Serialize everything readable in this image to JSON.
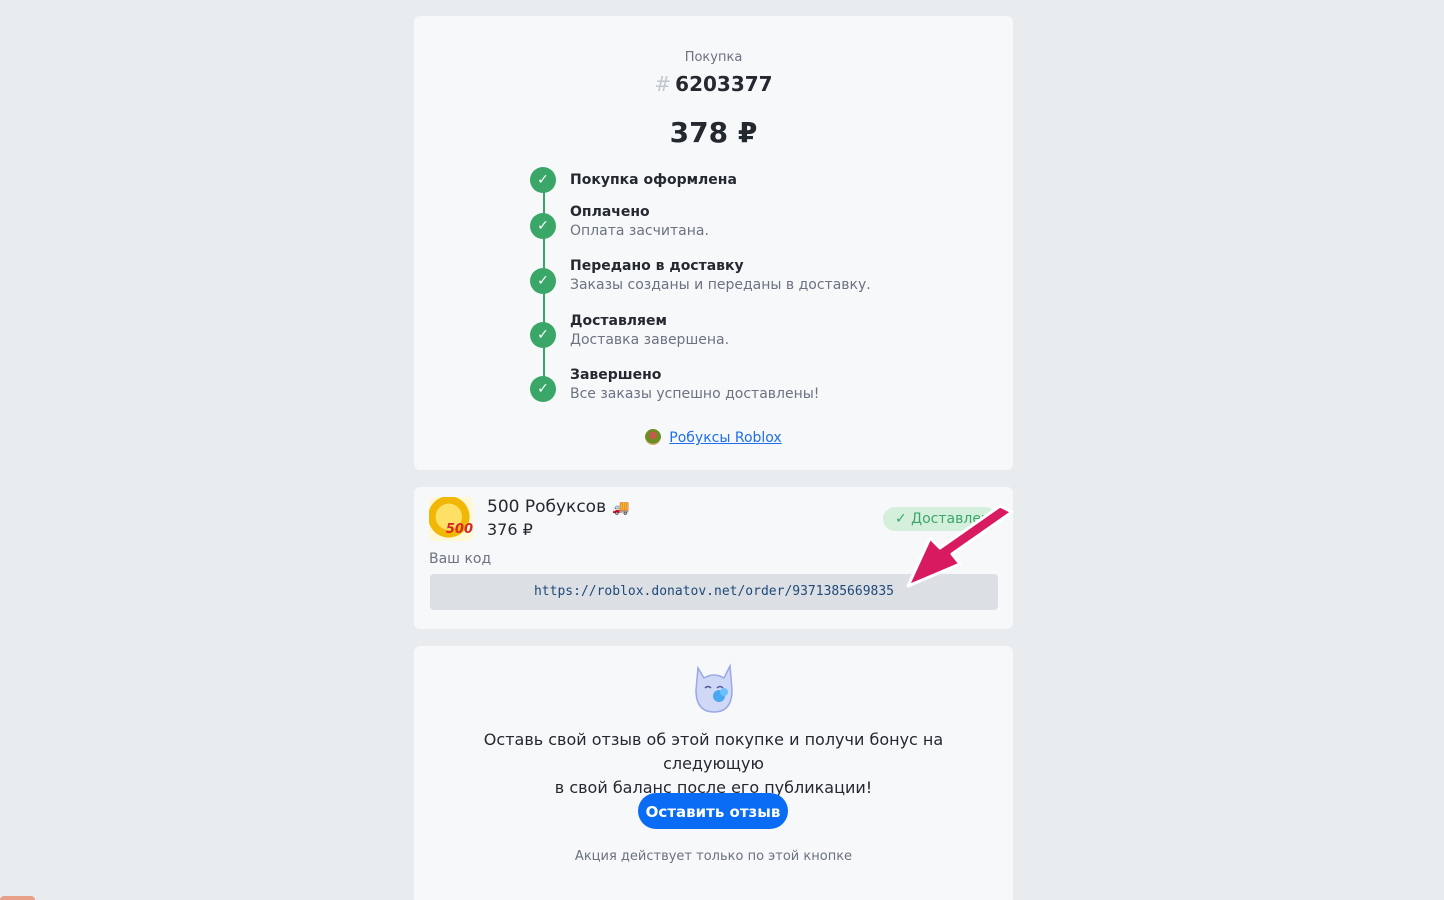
{
  "order": {
    "purchase_label": "Покупка",
    "hash_symbol": "#",
    "number": "6203377",
    "total": "378 ₽"
  },
  "steps": [
    {
      "title": "Покупка оформлена",
      "description": ""
    },
    {
      "title": "Оплачено",
      "description": "Оплата засчитана."
    },
    {
      "title": "Передано в доставку",
      "description": "Заказы созданы и переданы в доставку."
    },
    {
      "title": "Доставляем",
      "description": "Доставка завершена."
    },
    {
      "title": "Завершено",
      "description": "Все заказы успешно доставлены!"
    }
  ],
  "product_link": {
    "label": "Робуксы Roblox"
  },
  "item": {
    "name": "500 Робуксов",
    "truck_icon": "🚚",
    "thumb_number": "500",
    "price": "376 ₽",
    "status": "✓ Доставлен",
    "code_label": "Ваш код",
    "code": "https://roblox.donatov.net/order/9371385669835"
  },
  "review": {
    "text_line1": "Оставь свой отзыв об этой покупке и получи бонус на следующую",
    "text_line2": "в свой баланс после его публикации!",
    "button_label": "Оставить отзыв",
    "note": "Акция действует только по этой кнопке"
  },
  "icons": {
    "step_check": "check-icon",
    "arrow": "pointer-arrow-icon",
    "mascot": "mascot-cat-icon"
  },
  "colors": {
    "success": "#3aa769",
    "link": "#1f6feb",
    "primary_button": "#0a6cf5",
    "arrow": "#d81b60"
  }
}
